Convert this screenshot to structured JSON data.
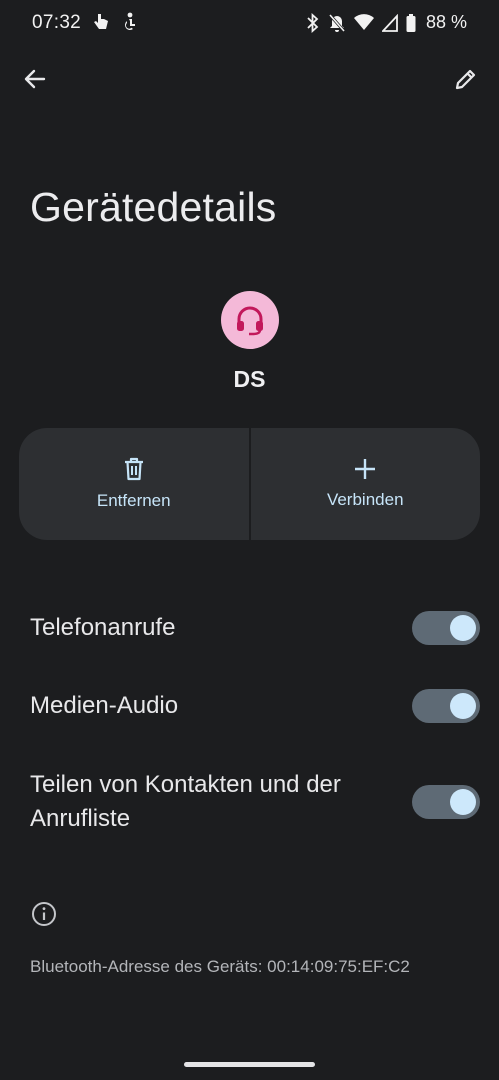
{
  "status_bar": {
    "time": "07:32",
    "battery_text": "88 %",
    "icons": [
      "hand-gesture-icon",
      "accessibility-icon",
      "bluetooth-icon",
      "do-not-disturb-off-icon",
      "wifi-icon",
      "signal-icon",
      "battery-icon"
    ]
  },
  "top_bar": {
    "back_icon": "arrow-back-icon",
    "edit_icon": "pencil-icon"
  },
  "page": {
    "title": "Gerätedetails"
  },
  "device": {
    "name": "DS",
    "icon": "headset-icon",
    "avatar_color": "#f4b9d8",
    "icon_color": "#c2185b"
  },
  "actions": [
    {
      "label": "Entfernen",
      "icon": "trash-icon"
    },
    {
      "label": "Verbinden",
      "icon": "plus-icon"
    }
  ],
  "settings": [
    {
      "label": "Telefonanrufe",
      "enabled": true
    },
    {
      "label": "Medien-Audio",
      "enabled": true
    },
    {
      "label": "Teilen von Kontakten und der Anrufliste",
      "enabled": true
    }
  ],
  "footer": {
    "info_icon": "info-icon",
    "bluetooth_address": "Bluetooth-Adresse des Geräts: 00:14:09:75:EF:C2"
  },
  "colors": {
    "background": "#1c1d1f",
    "button_surface": "#2d2f32",
    "accent_text": "#c6e4f8",
    "toggle_track": "#5e6a75",
    "toggle_knob": "#cde8fb"
  }
}
